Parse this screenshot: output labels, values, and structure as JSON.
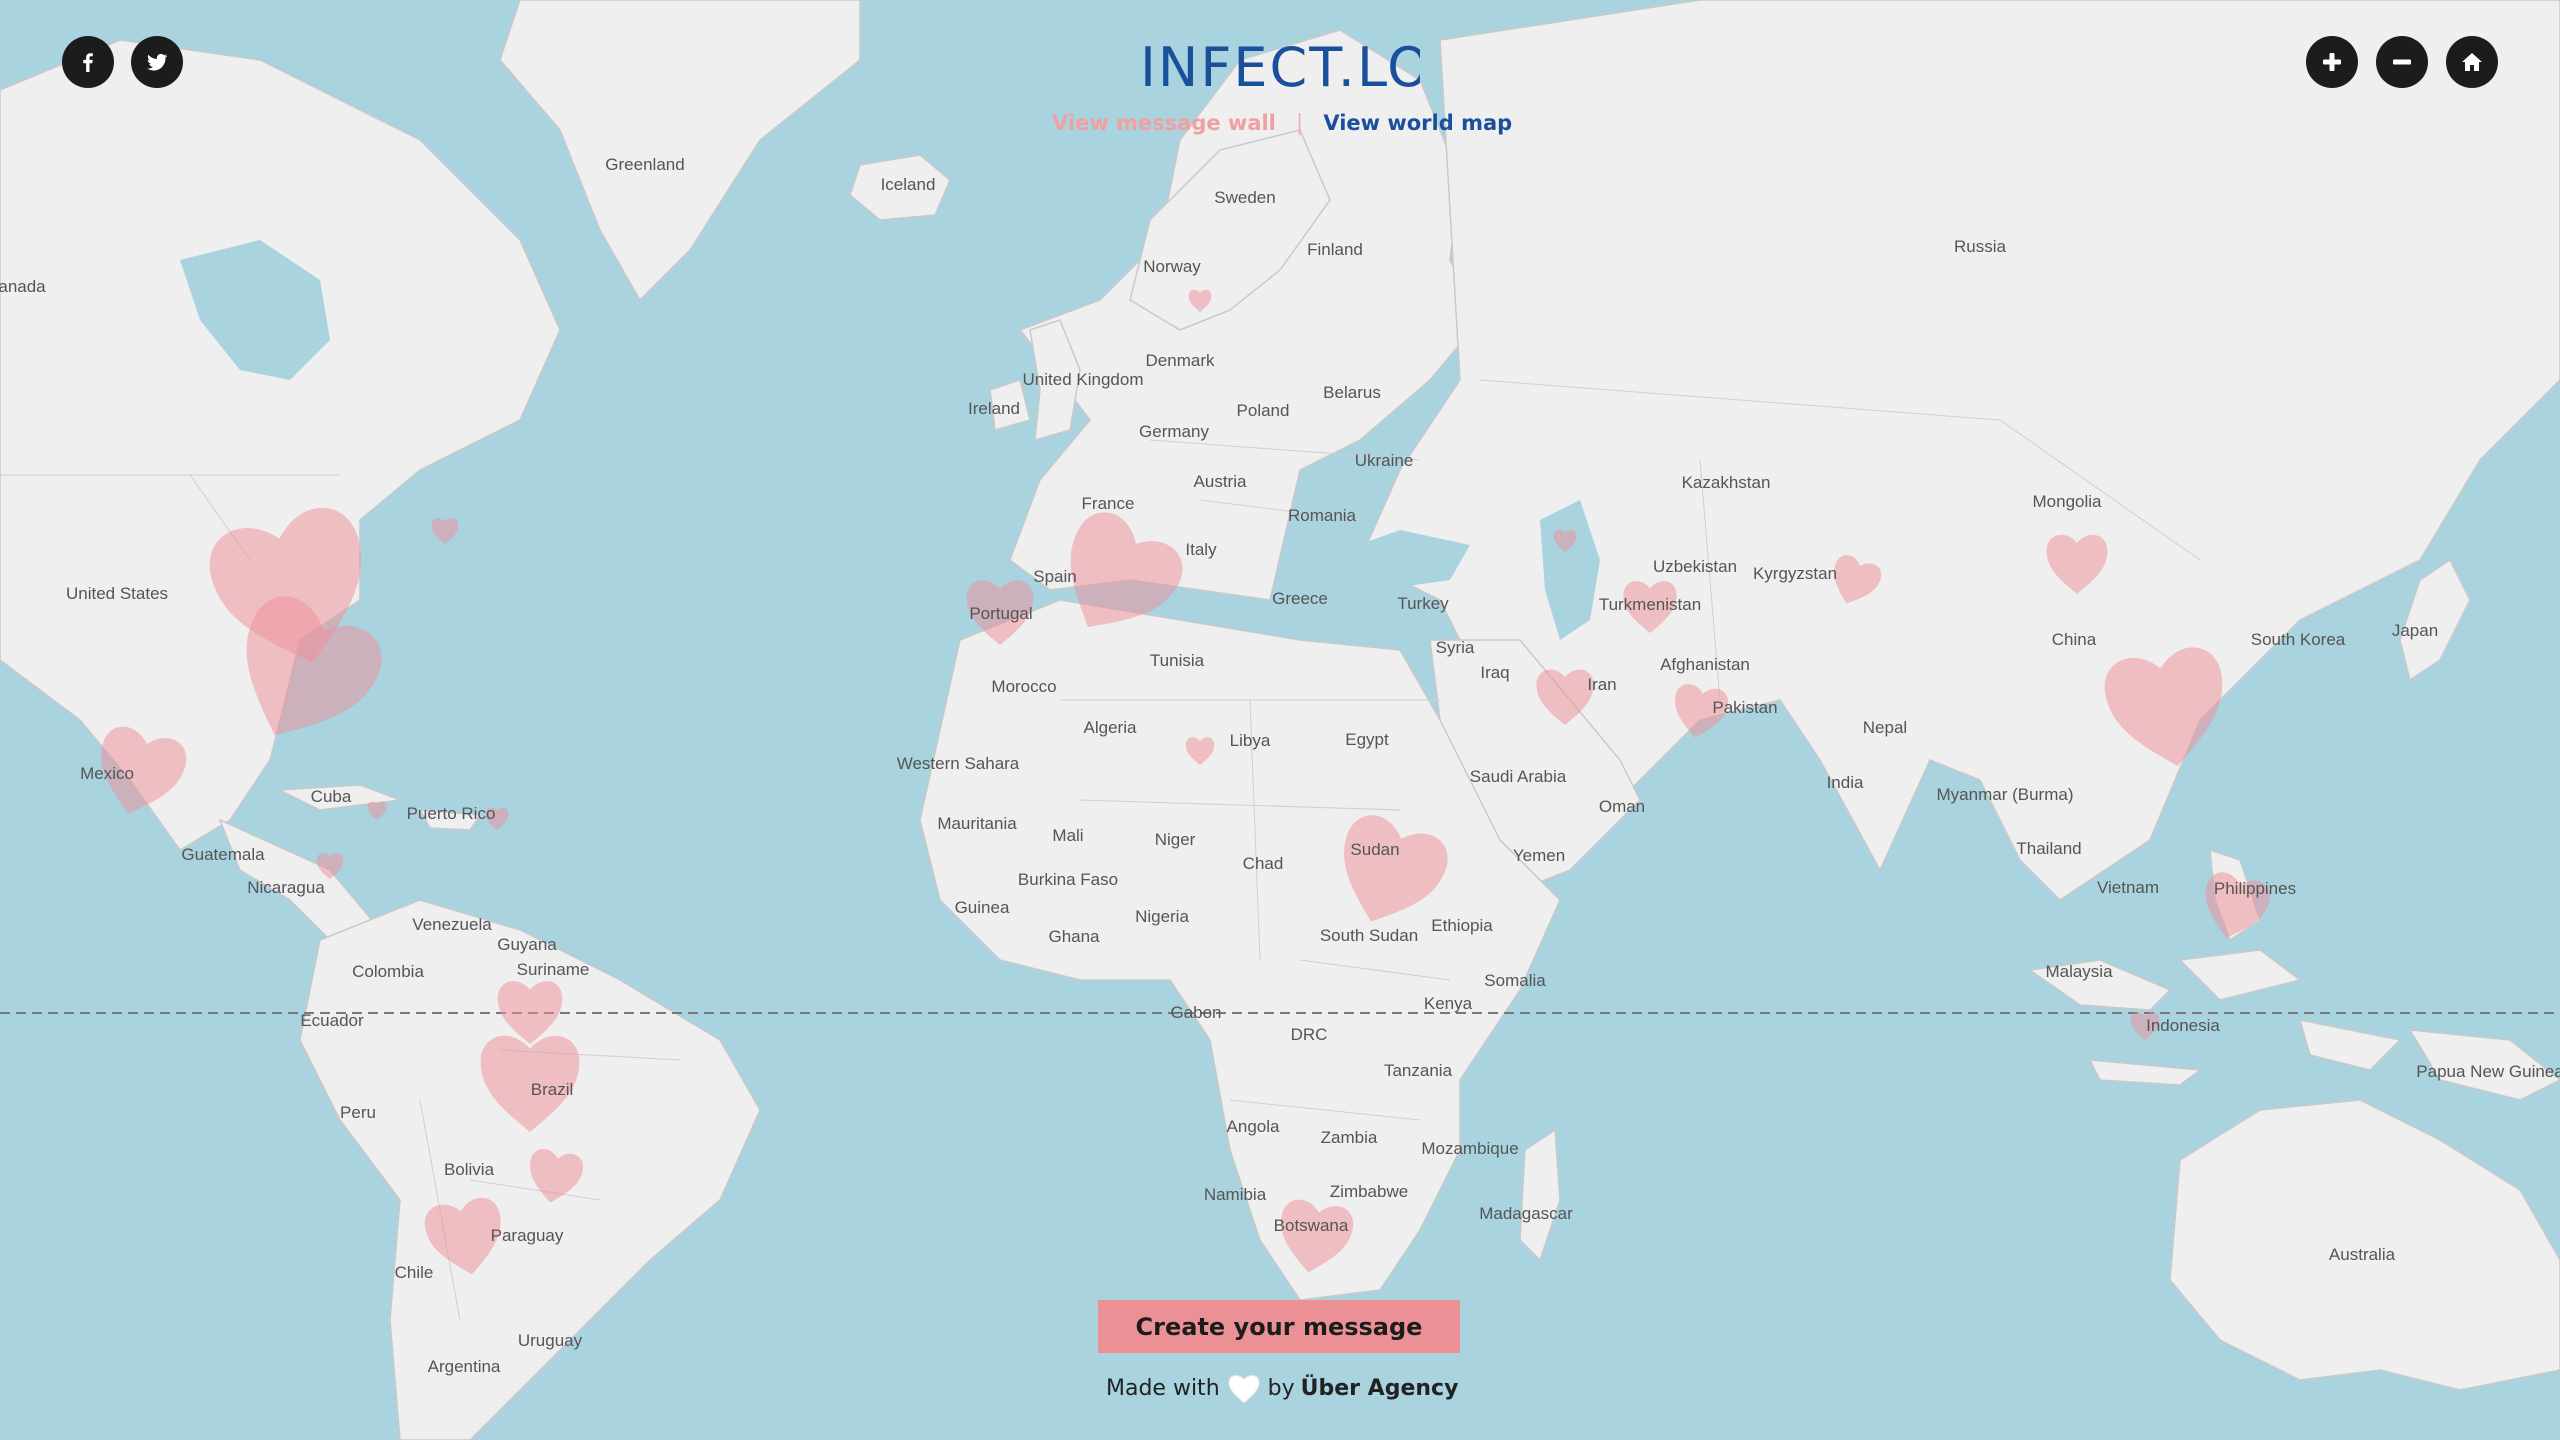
{
  "app": {
    "logo_text": "INFECT.LOVE",
    "logo_color": "#1a4f9c"
  },
  "social": {
    "facebook_icon": "facebook-f",
    "twitter_icon": "twitter-bird"
  },
  "zoom_controls": {
    "zoom_in_icon": "plus",
    "zoom_out_icon": "minus",
    "home_icon": "home"
  },
  "nav": {
    "message_wall": "View message wall",
    "separator": "|",
    "world_map": "View world map"
  },
  "actions": {
    "create_message": "Create your message"
  },
  "footer": {
    "made_with": "Made with",
    "by": "by",
    "agency": "Über Agency"
  },
  "colors": {
    "ocean": "#a9d3df",
    "land": "#efefef",
    "heart": "#ef8e97",
    "create_button": "#eb9196",
    "link_active": "#1a4f9c",
    "link_inactive": "#f1a0a0"
  },
  "map_labels": [
    "Greenland",
    "Iceland",
    "Sweden",
    "Finland",
    "Norway",
    "Russia",
    "anada",
    "United Kingdom",
    "Ireland",
    "Denmark",
    "Poland",
    "Belarus",
    "Germany",
    "Ukraine",
    "Kazakhstan",
    "Mongolia",
    "France",
    "Austria",
    "Romania",
    "Italy",
    "Spain",
    "Portugal",
    "Greece",
    "Turkey",
    "Uzbekistan",
    "Kyrgyzstan",
    "Turkmenistan",
    "Syria",
    "Iraq",
    "Iran",
    "Afghanistan",
    "Pakistan",
    "Nepal",
    "China",
    "South Korea",
    "Japan",
    "India",
    "Myanmar (Burma)",
    "Thailand",
    "Vietnam",
    "Philippines",
    "Malaysia",
    "Indonesia",
    "Papua New Guinea",
    "Australia",
    "United States",
    "Mexico",
    "Cuba",
    "Puerto Rico",
    "Guatemala",
    "Nicaragua",
    "Venezuela",
    "Guyana",
    "Suriname",
    "Colombia",
    "Ecuador",
    "Peru",
    "Brazil",
    "Bolivia",
    "Paraguay",
    "Chile",
    "Uruguay",
    "Argentina",
    "Tunisia",
    "Morocco",
    "Algeria",
    "Libya",
    "Egypt",
    "Western Sahara",
    "Mauritania",
    "Mali",
    "Niger",
    "Chad",
    "Sudan",
    "Burkina Faso",
    "Guinea",
    "Ghana",
    "Nigeria",
    "South Sudan",
    "Ethiopia",
    "Somalia",
    "Saudi Arabia",
    "Oman",
    "Yemen",
    "Gabon",
    "DRC",
    "Kenya",
    "Tanzania",
    "Angola",
    "Zambia",
    "Mozambique",
    "Zimbabwe",
    "Namibia",
    "Botswana",
    "Madagascar"
  ]
}
